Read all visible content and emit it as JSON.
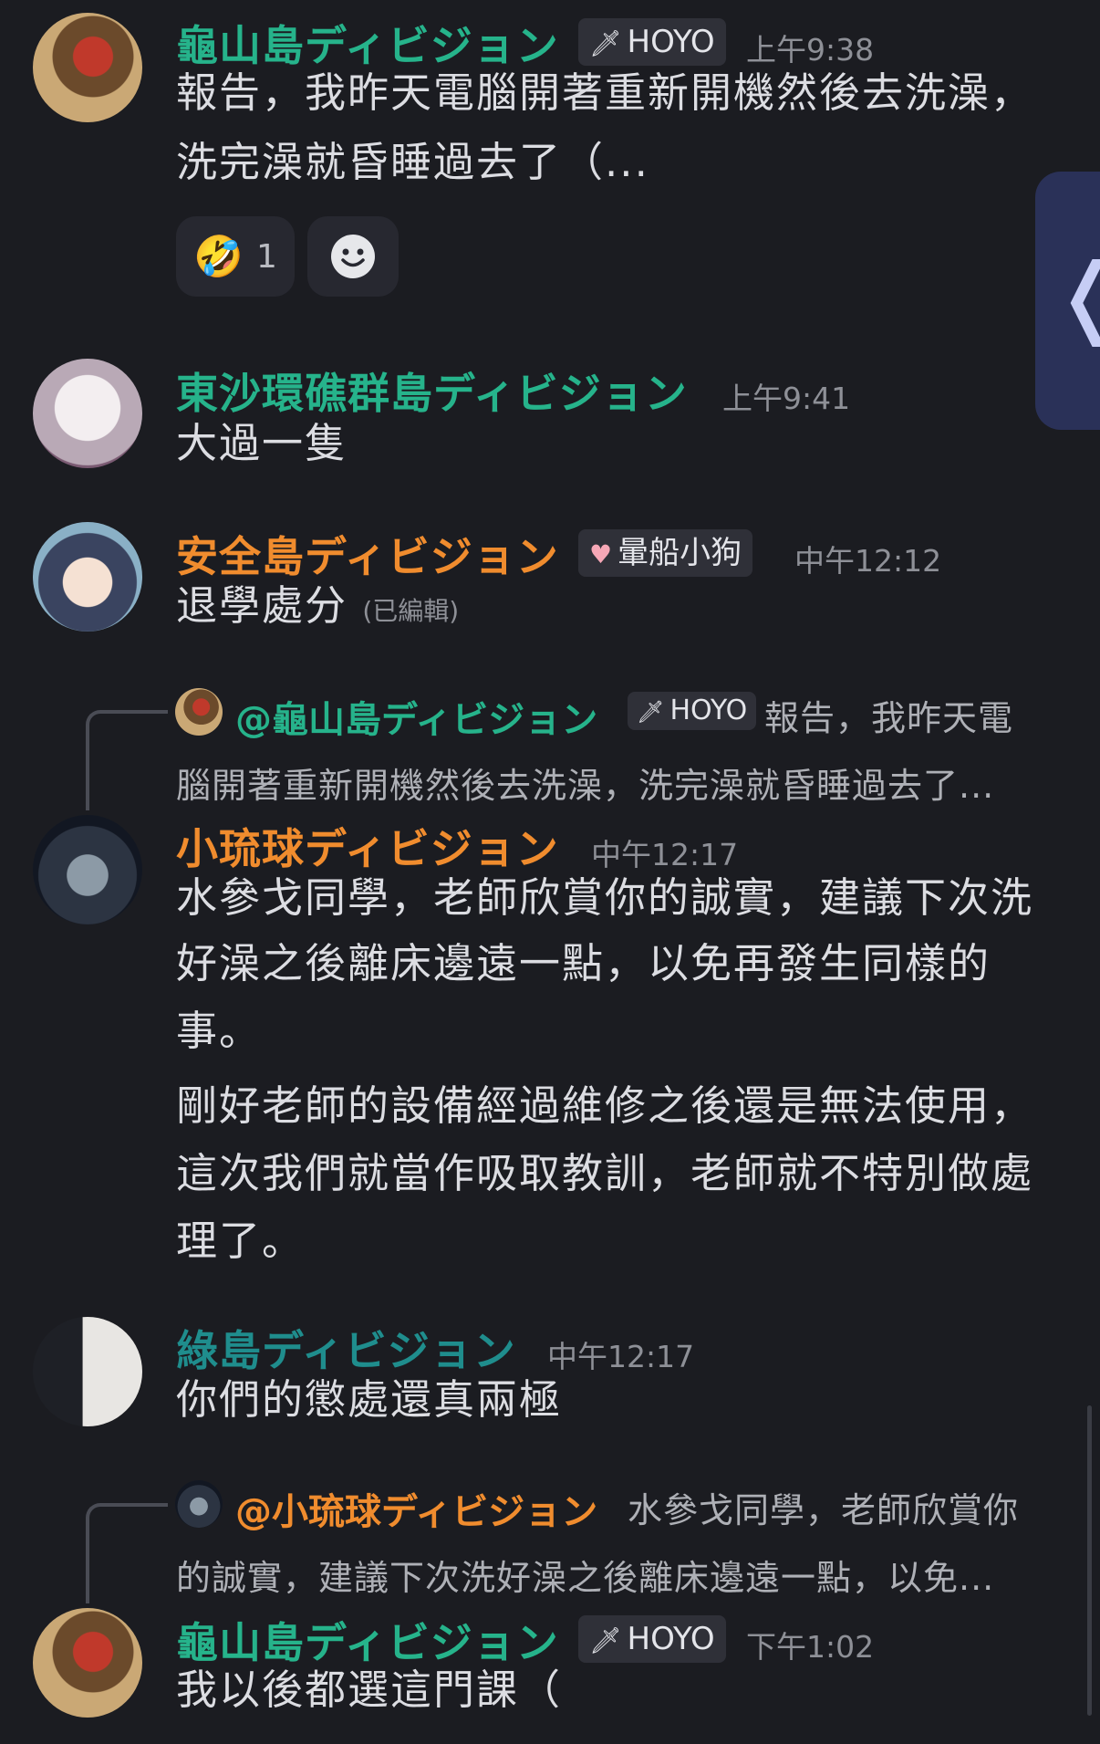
{
  "messages": [
    {
      "author": "龜山島ディビジョン",
      "tag": "HOYO",
      "time": "上午9:38",
      "lines": [
        "報告，我昨天電腦開著重新開機然後去洗澡，",
        "洗完澡就昏睡過去了（..."
      ],
      "reactions": [
        {
          "emoji": "🤣",
          "count": "1"
        }
      ]
    },
    {
      "author": "東沙環礁群島ディビジョン",
      "time": "上午9:41",
      "lines": [
        "大過一隻"
      ]
    },
    {
      "author": "安全島ディビジョン",
      "tag": "暈船小狗",
      "time": "中午12:12",
      "lines": [
        "退學處分"
      ],
      "edited": "(已編輯)"
    },
    {
      "reply": {
        "author": "@龜山島ディビジョン",
        "tag": "HOYO",
        "line1": "報告，我昨天電",
        "line2": "腦開著重新開機然後去洗澡，洗完澡就昏睡過去了..."
      },
      "author": "小琉球ディビジョン",
      "time": "中午12:17",
      "lines": [
        "水參戈同學，老師欣賞你的誠實，建議下次洗",
        "好澡之後離床邊遠一點，以免再發生同樣的",
        "事。",
        "剛好老師的設備經過維修之後還是無法使用，",
        "這次我們就當作吸取教訓，老師就不特別做處",
        "理了。"
      ]
    },
    {
      "author": "綠島ディビジョン",
      "time": "中午12:17",
      "lines": [
        "你們的懲處還真兩極"
      ]
    },
    {
      "reply": {
        "author": "@小琉球ディビジョン",
        "line1": "水參戈同學，老師欣賞你",
        "line2": "的誠實，建議下次洗好澡之後離床邊遠一點，以免..."
      },
      "author": "龜山島ディビジョン",
      "tag": "HOYO",
      "time": "下午1:02",
      "lines": [
        "我以後都選這門課（"
      ]
    }
  ],
  "side_tab": {
    "glyph": "❬"
  },
  "colors": {
    "background": "#1b1c21",
    "green_name": "#26b38b",
    "orange_name": "#f08c2e",
    "teal_name": "#1f8d8d"
  }
}
